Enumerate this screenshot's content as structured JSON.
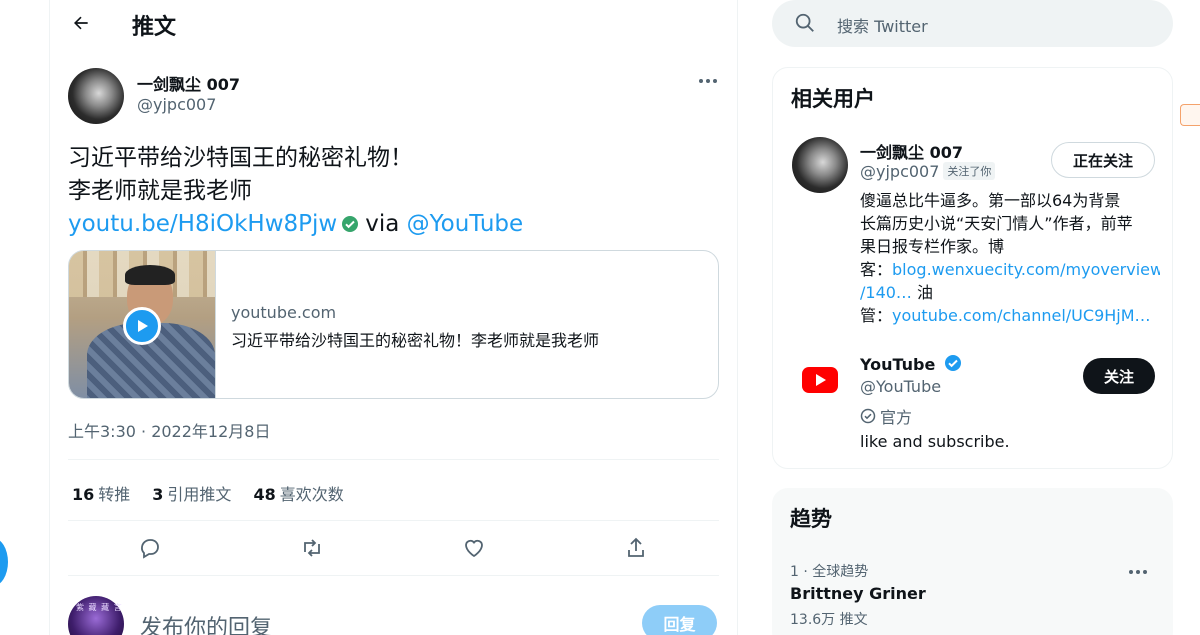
{
  "header": {
    "title": "推文"
  },
  "tweet": {
    "author_name": "一剑飘尘 007",
    "author_handle": "@yjpc007",
    "text_line1": "习近平带给沙特国王的秘密礼物！",
    "text_line2": "李老师就是我老师",
    "link_text": "youtu.be/H8iOkHw8Pjw",
    "via_text": "via",
    "mention_text": "@YouTube",
    "card": {
      "domain": "youtube.com",
      "title": "习近平带给沙特国王的秘密礼物！李老师就是我老师"
    },
    "timestamp": "上午3:30 · 2022年12月8日",
    "stats": {
      "retweets_count": "16",
      "retweets_label": "转推",
      "quotes_count": "3",
      "quotes_label": "引用推文",
      "likes_count": "48",
      "likes_label": "喜欢次数"
    }
  },
  "reply": {
    "placeholder": "发布你的回复",
    "button_label": "回复",
    "avatar_text": "紫 藏 藏 言"
  },
  "search": {
    "placeholder": "搜索 Twitter"
  },
  "related_users": {
    "title": "相关用户",
    "users": [
      {
        "name": "一剑飘尘 007",
        "handle": "@yjpc007",
        "follows_you": "关注了你",
        "button": "正在关注",
        "bio_line1": "傻逼总比牛逼多。第一部以64为背景",
        "bio_line2": "长篇历史小说“天安门情人”作者，前苹",
        "bio_line3": "果日报专栏作家。博",
        "bio_line4_prefix": "客：",
        "bio_line4_link": "blog.wenxuecity.com/myoverview",
        "bio_line5_link": "/140…",
        "bio_line5_suffix": " 油",
        "bio_line6_prefix": "管：",
        "bio_line6_link": "youtube.com/channel/UC9HjM…"
      },
      {
        "name": "YouTube",
        "handle": "@YouTube",
        "button": "关注",
        "official_label": "官方",
        "bio": "like and subscribe."
      }
    ]
  },
  "trends": {
    "title": "趋势",
    "items": [
      {
        "meta": "1 · 全球趋势",
        "name": "Brittney Griner",
        "count": "13.6万 推文"
      }
    ]
  },
  "colors": {
    "accent": "#1d9bf0",
    "text_primary": "#0f1419",
    "text_secondary": "#536471",
    "youtube_red": "#ff0000"
  },
  "icons": [
    "back-arrow-icon",
    "more-icon",
    "verified-icon",
    "play-icon",
    "reply-icon",
    "retweet-icon",
    "like-icon",
    "share-icon",
    "search-icon",
    "youtube-logo-icon",
    "official-badge-icon"
  ]
}
